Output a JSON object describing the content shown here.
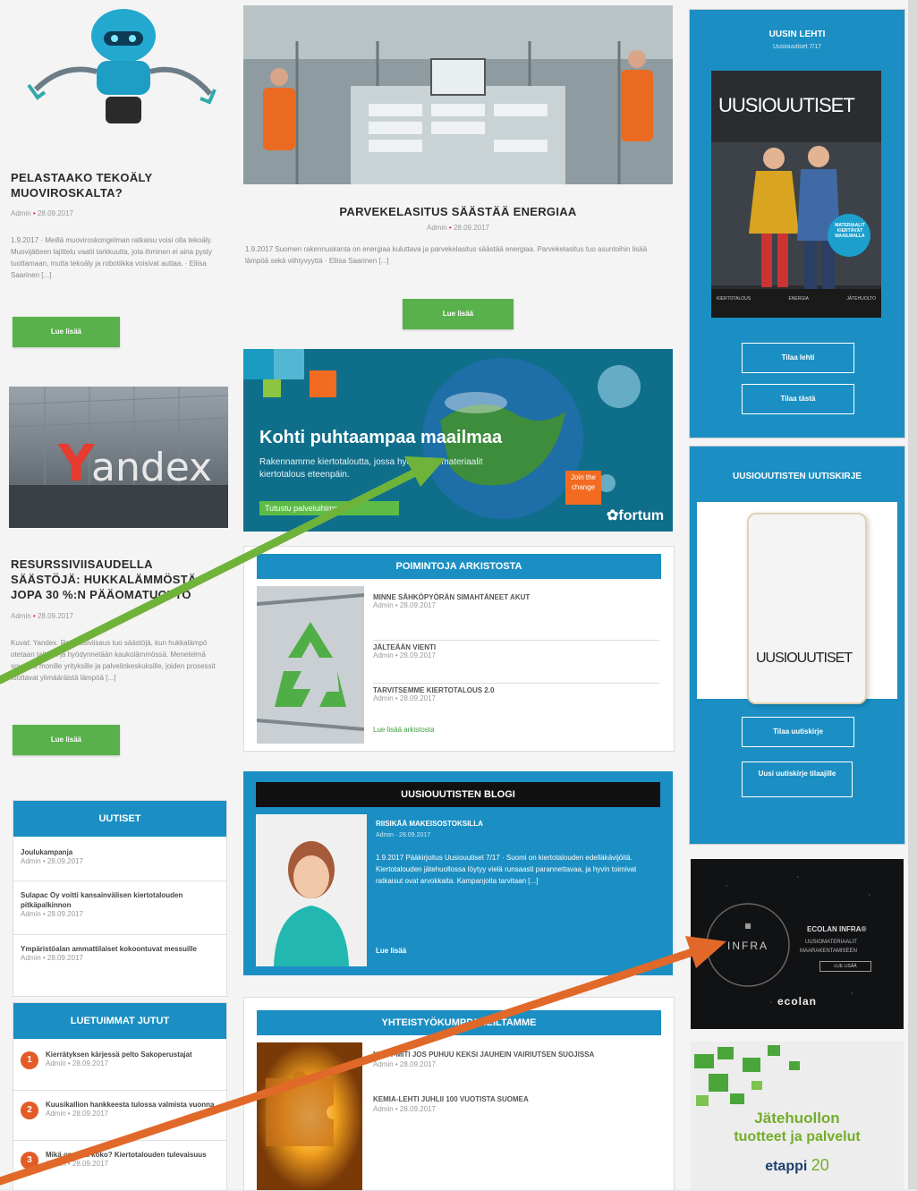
{
  "left_column": {
    "article1": {
      "title": "PELASTAAKO TEKOÄLY MUOVIROSKALTA?",
      "meta_author": "Admin",
      "meta_date": "28.09.2017",
      "excerpt": "1.9.2017 · Meillä muoviroskongelman ratkaisu voisi olla tekoäly. Muovijätteen lajittelu vaatii tarkkuutta, jota ihminen ei aina pysty tuottamaan, mutta tekoäly ja robotiikka voisivat auttaa. · Eliisa Saarinen [...]",
      "button": "Lue lisää"
    },
    "article2": {
      "title": "RESURSSIVIISAUDELLA SÄÄSTÖJÄ: HUKKALÄMMÖSTÄ JOPA 30 %:N PÄÄOMATUOTTO",
      "meta_author": "Admin",
      "meta_date": "28.09.2017",
      "excerpt": "Kuvat: Yandex. Resurssiviisaus tuo säästöjä, kun hukkalämpö otetaan talteen ja hyödynnetään kaukolämmössä. Menetelmä soveltuu monille yrityksille ja palvelinkeskuksille, joiden prosessit tuottavat ylimääräistä lämpöä [...]",
      "button": "Lue lisää"
    },
    "uutiset": {
      "header": "UUTISET",
      "items": [
        {
          "title": "Joulukampanja",
          "meta": "Admin • 28.09.2017"
        },
        {
          "title": "Sulapac Oy voitti kansainvälisen kiertotalouden pitkäpalkinnon",
          "meta": "Admin • 28.09.2017"
        },
        {
          "title": "Ympäristöalan ammattilaiset kokoontuvat messuille",
          "meta": "Admin • 28.09.2017"
        }
      ]
    },
    "luetuimmat": {
      "header": "LUETUIMMAT JUTUT",
      "items": [
        {
          "rank": "1",
          "title": "Kierrätyksen kärjessä pelto Sakoperustajat",
          "meta": "Admin • 28.09.2017"
        },
        {
          "rank": "2",
          "title": "Kuusikallion hankkeesta tulossa valmista vuonna",
          "meta": "Admin • 28.09.2017"
        },
        {
          "rank": "3",
          "title": "Mikä on muu koko? Kiertotalouden tulevaisuus",
          "meta": "Admin • 28.09.2017"
        }
      ]
    }
  },
  "mid_column": {
    "feature": {
      "title": "PARVEKELASITUS SÄÄSTÄÄ ENERGIAA",
      "meta_author": "Admin",
      "meta_date": "28.09.2017",
      "excerpt": "1.9.2017 Suomen rakennuskanta on energiaa kuluttava ja parvekelasitus säästää energiaa. Parvekelasitus tuo asuntoihin lisää lämpöä sekä viihtyvyyttä · Eliisa Saarinen [...]",
      "button": "Lue lisää"
    },
    "ad": {
      "headline": "Kohti puhtaampaa maailmaa",
      "body": "Rakennamme kiertotaloutta, jossa hyödylliset materiaalit kiertotalous eteenpäin.",
      "cta": "Tutustu palveluihimme",
      "badge": "Join the change",
      "brand": "fortum"
    },
    "pointing": {
      "header": "POIMINTOJA ARKISTOSTA",
      "items": [
        {
          "title": "MINNE SÄHKÖPYÖRÄN SIMAHTÄNEET AKUT",
          "meta": "Admin • 28.09.2017"
        },
        {
          "title": "JÄLTEÄÄN VIENTI",
          "meta": "Admin • 28.09.2017"
        },
        {
          "title": "TARVITSEMME KIERTOTALOUS 2.0",
          "meta": "Admin • 28.09.2017"
        }
      ],
      "more": "Lue lisää arkistosta"
    },
    "blog": {
      "header": "UUSIOUUTISTEN BLOGI",
      "title": "RIISIKÄÄ MAKEISOSTOKSILLA",
      "meta": "Admin · 28.09.2017",
      "excerpt": "1.9.2017 Pääkirjoitus Uusiouutiset 7/17 · Suomi on kiertotalouden edelläkävijöitä. Kiertotalouden jätehuollossa löytyy vielä runsaasti parannettavaa, ja hyvin toimivat ratkaisut ovat arvokkaita. Kampanjoita tarvitaan [...]",
      "more": "Lue lisää"
    },
    "coop": {
      "header": "YHTEISTYÖKUMPPANEILTAMME",
      "items": [
        {
          "title": "NAVIT-MITI JOS PUHUU KEKSI JAUHEIN VAIRIUTSEN SUOJISSA",
          "meta": "Admin • 28.09.2017"
        },
        {
          "title": "KEMIA-LEHTI JUHLII 100 VUOTISTA SUOMEA",
          "meta": "Admin • 28.09.2017"
        }
      ]
    }
  },
  "right_column": {
    "uusin": {
      "header": "UUSIN LEHTI",
      "subheader": "Uusiouutiset 7/17",
      "magazine_title": "UUSIOUUTISET",
      "cover_badge": "MATERIAALIT KIERTÄVÄT MAAILMALLA",
      "cover_foot": [
        "KIERTOTALOUS",
        "ENERGIA",
        "JÄTEHUOLTO"
      ],
      "btn1": "Tilaa lehti",
      "btn2": "Tilaa tästä"
    },
    "newsletter": {
      "header": "UUSIOUUTISTEN UUTISKIRJE",
      "magazine_title": "UUSIOUUTISET",
      "btn1": "Tilaa uutiskirje",
      "btn2": "Uusi uutiskirje tilaajille"
    },
    "ecolan": {
      "logo_text": "INFRA",
      "title": "ECOLAN INFRA®",
      "line1": "UUSIOMATERIAALIT",
      "line2": "MAARAKENTAMISEEN",
      "button": "LUE LISÄÄ",
      "brand": "ecolan"
    },
    "jatehuolto": {
      "line1": "Jätehuollon",
      "line2": "tuotteet ja palvelut",
      "brand": "etappi",
      "number": "20"
    }
  },
  "colors": {
    "accent_blue": "#1b8fc3",
    "green": "#58b14a",
    "orange_arrow": "#e0692a",
    "green_arrow": "#6fb33b"
  }
}
